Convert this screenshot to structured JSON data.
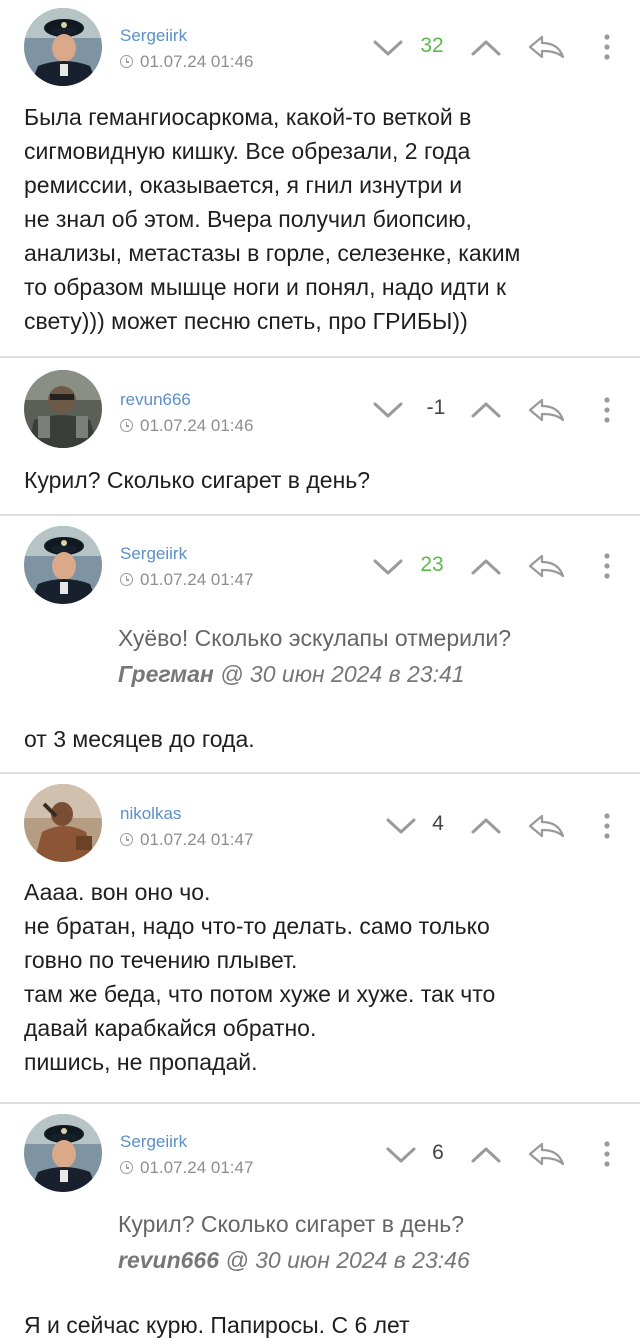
{
  "comments": [
    {
      "username": "Sergeiirk",
      "timestamp": "01.07.24 01:46",
      "rating": "32",
      "rating_class": "pos",
      "text": "Была гемангиосаркома, какой-то веткой в\nсигмовидную кишку. Все обрезали, 2 года\nремиссии, оказывается, я гнил изнутри и\nне знал об этом. Вчера получил биопсию,\nанализы, метастазы в горле, селезенке, каким\nто образом мышце ноги и понял, надо идти к\nсвету))) может песню спеть, про ГРИБЫ))"
    },
    {
      "username": "revun666",
      "timestamp": "01.07.24 01:46",
      "rating": "-1",
      "rating_class": "neu",
      "text": "Курил? Сколько сигарет в день?"
    },
    {
      "username": "Sergeiirk",
      "timestamp": "01.07.24 01:47",
      "rating": "23",
      "rating_class": "pos",
      "quote_text": "Хуёво! Сколько эскулапы отмерили?",
      "quote_author": "Грегман",
      "quote_meta": " @ 30 июн 2024 в 23:41",
      "text": "от 3 месяцев до года."
    },
    {
      "username": "nikolkas",
      "timestamp": "01.07.24 01:47",
      "rating": "4",
      "rating_class": "neu",
      "text": "Аааа. вон оно чо.\nне братан, надо что-то делать. само только\nговно по течению плывет.\nтам же беда, что потом хуже и хуже. так что\nдавай карабкайся обратно.\nпишись, не пропадай."
    },
    {
      "username": "Sergeiirk",
      "timestamp": "01.07.24 01:47",
      "rating": "6",
      "rating_class": "neu",
      "quote_text": "Курил? Сколько сигарет в день?",
      "quote_author": "revun666",
      "quote_meta": " @ 30 июн 2024 в 23:46",
      "text": "Я и сейчас курю. Папиросы. С 6 лет"
    }
  ],
  "icons": {
    "vote_down": "chevron-down-icon",
    "vote_up": "chevron-up-icon",
    "reply": "reply-arrow-icon",
    "more": "more-vertical-icon"
  },
  "colors": {
    "username": "#5b8fc7",
    "rating_positive": "#5eb84d",
    "separator": "#dcdcdc"
  }
}
